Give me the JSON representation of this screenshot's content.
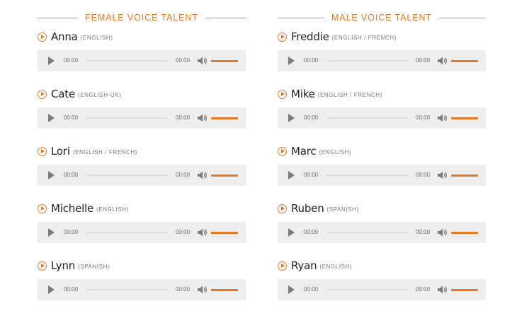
{
  "colors": {
    "accent": "#e87722",
    "player_bg": "#eeeeee"
  },
  "female": {
    "heading": "FEMALE VOICE TALENT",
    "voices": [
      {
        "name": "Anna",
        "lang": "(ENGLISH)",
        "current": "00:00",
        "duration": "00:00"
      },
      {
        "name": "Cate",
        "lang": "(ENGLISH-UK)",
        "current": "00:00",
        "duration": "00:00"
      },
      {
        "name": "Lori",
        "lang": "(ENGLISH / FRENCH)",
        "current": "00:00",
        "duration": "00:00"
      },
      {
        "name": "Michelle",
        "lang": "(ENGLISH)",
        "current": "00:00",
        "duration": "00:00"
      },
      {
        "name": "Lynn",
        "lang": "(SPANISH)",
        "current": "00:00",
        "duration": "00:00"
      }
    ]
  },
  "male": {
    "heading": "MALE VOICE TALENT",
    "voices": [
      {
        "name": "Freddie",
        "lang": "(ENGLISH / FRENCH)",
        "current": "00:00",
        "duration": "00:00"
      },
      {
        "name": "Mike",
        "lang": "(ENGLISH / FRENCH)",
        "current": "00:00",
        "duration": "00:00"
      },
      {
        "name": "Marc",
        "lang": "(ENGLISH)",
        "current": "00:00",
        "duration": "00:00"
      },
      {
        "name": "Ruben",
        "lang": "(SPANISH)",
        "current": "00:00",
        "duration": "00:00"
      },
      {
        "name": "Ryan",
        "lang": "(ENGLISH)",
        "current": "00:00",
        "duration": "00:00"
      }
    ]
  }
}
